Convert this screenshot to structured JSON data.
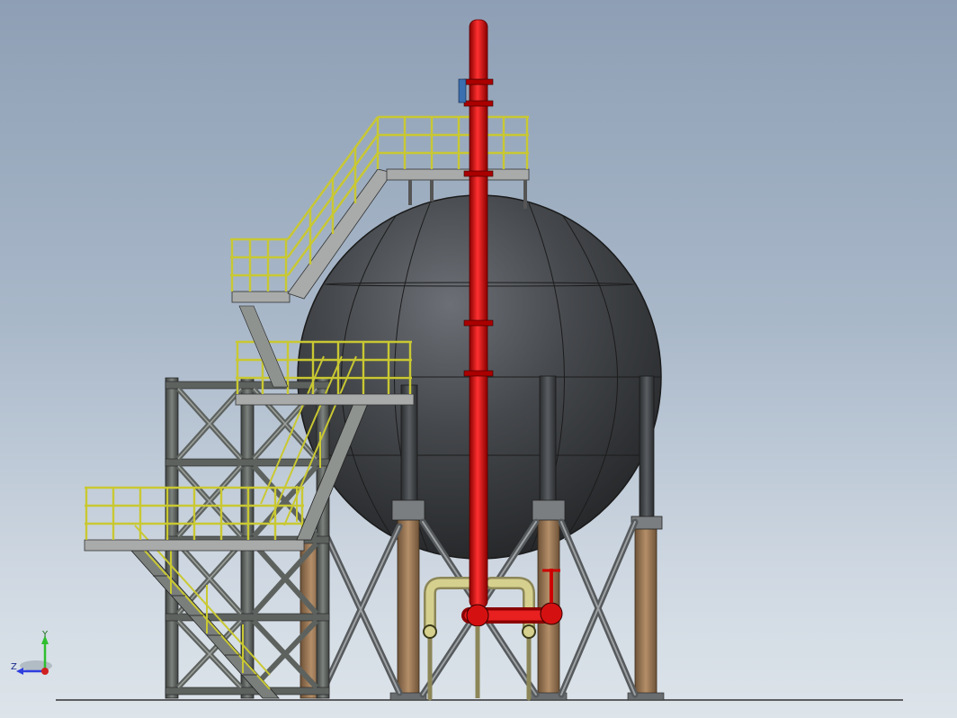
{
  "viewport": {
    "background_top": "#8e9fb5",
    "background_bottom": "#dde4ea"
  },
  "model": {
    "tank_color": "#3e4043",
    "pipe_color": "#d10d0d",
    "railing_color": "#c9c832",
    "steel_color": "#5d625f",
    "leg_color": "#9a7a5a",
    "auxiliary_pipe_color": "#c6c080"
  },
  "triad": {
    "y_label": "Y",
    "z_label": "Z",
    "y_color": "#2fbf2f",
    "z_color": "#2f3fdf",
    "x_color": "#d02020"
  }
}
